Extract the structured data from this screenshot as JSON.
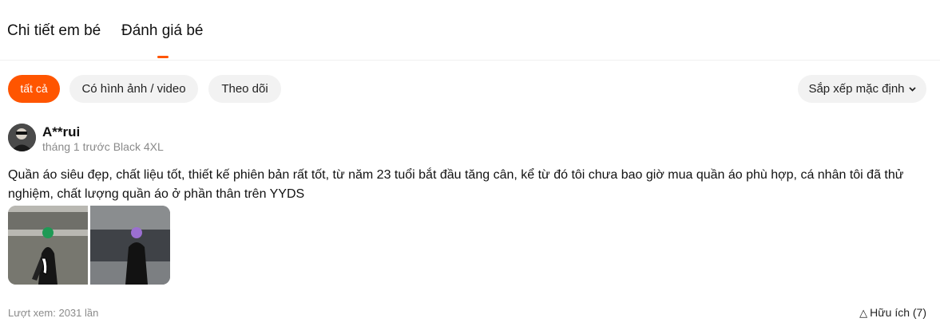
{
  "tabs": {
    "detail_label": "Chi tiết em bé",
    "reviews_label": "Đánh giá bé"
  },
  "filters": {
    "all_label": "tất cả",
    "media_label": "Có hình ảnh / video",
    "follow_label": "Theo dõi",
    "sort_label": "Sắp xếp mặc định",
    "sort_icon": "chevron-down-icon"
  },
  "review": {
    "username": "A**rui",
    "time": "tháng 1 trước",
    "sku": "Black 4XL",
    "text": "Quần áo siêu đẹp, chất liệu tốt, thiết kế phiên bản rất tốt, từ năm 23 tuổi bắt đầu tăng cân, kể từ đó tôi chưa bao giờ mua quần áo phù hợp, cá nhân tôi đã thử nghiệm, chất lượng quần áo ở phần thân trên YYDS",
    "views": "Lượt xem: 2031 lần",
    "helpful_icon": "triangle-outline-icon",
    "helpful_symbol": "△",
    "helpful_label": "Hữu ích (7)"
  },
  "colors": {
    "accent": "#ff5500",
    "chip_bg": "#f2f2f2",
    "muted_text": "#8a8a8a"
  }
}
